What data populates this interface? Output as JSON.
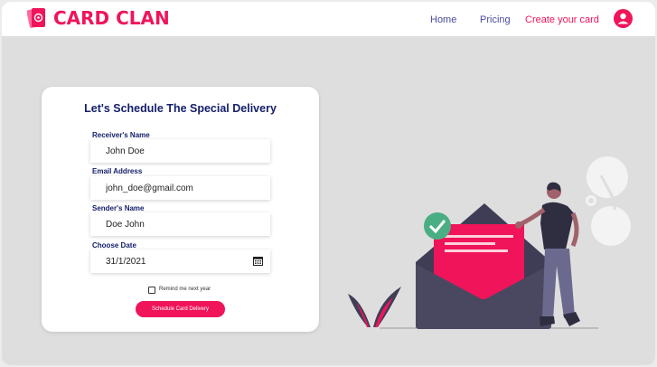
{
  "nav": {
    "brand": "CARD CLAN",
    "links": [
      "Home",
      "Pricing"
    ],
    "cta": "Create your card"
  },
  "form": {
    "title": "Let's Schedule The Special Delivery",
    "fields": [
      {
        "label": "Receiver's Name",
        "value": "John Doe"
      },
      {
        "label": "Email Address",
        "value": "john_doe@gmail.com"
      },
      {
        "label": "Sender's Name",
        "value": "Doe John"
      },
      {
        "label": "Choose Date",
        "value": "31/1/2021"
      }
    ],
    "remind_label": "Remind me next year",
    "remind_checked": false,
    "submit_label": "Schedule Card Delivery"
  },
  "colors": {
    "accent": "#f0145a",
    "navy": "#15206b",
    "background": "#dedede",
    "check_green": "#4aae84"
  },
  "icons": {
    "logo": "card-logo-icon",
    "avatar": "user-avatar-icon",
    "calendar": "calendar-icon"
  }
}
